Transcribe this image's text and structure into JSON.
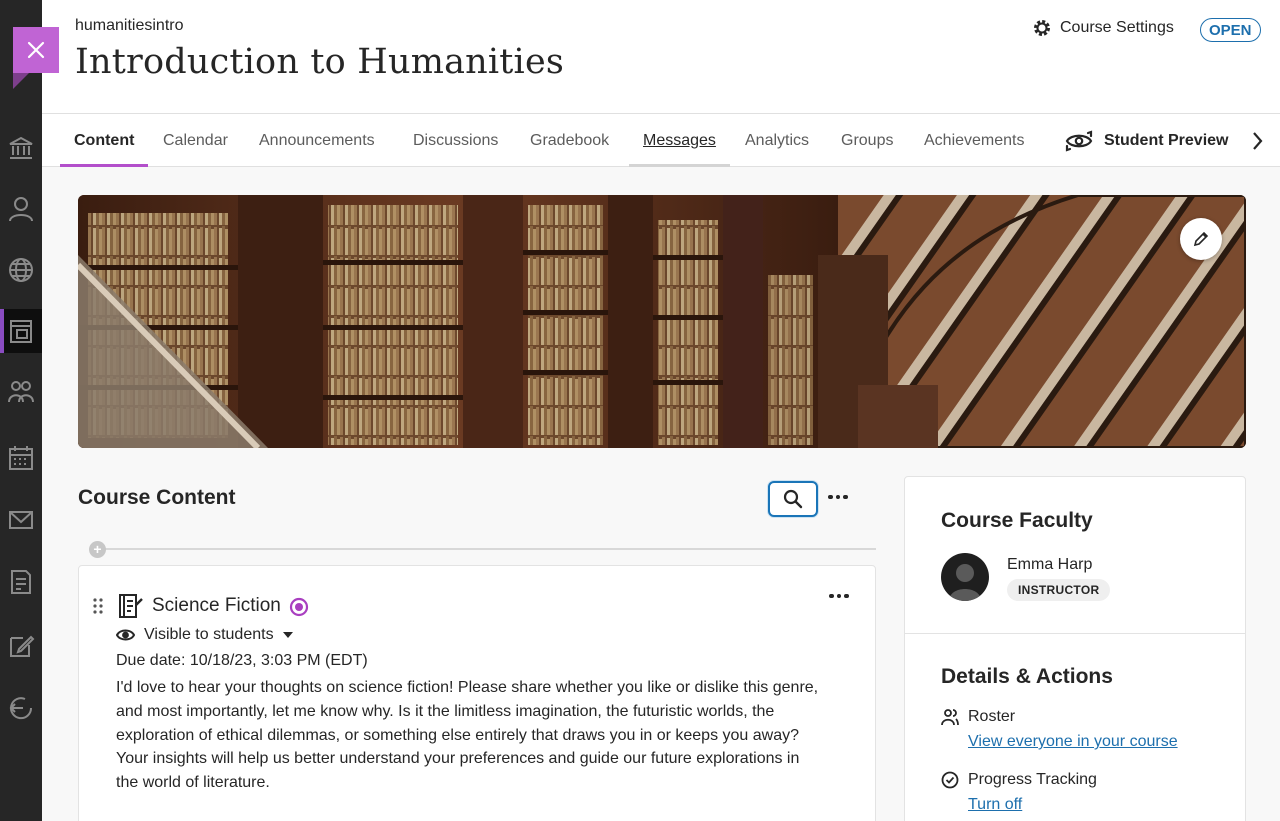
{
  "header": {
    "course_id": "humanitiesintro",
    "course_title": "Introduction to Humanities",
    "settings_label": "Course Settings",
    "status_badge": "OPEN"
  },
  "rail": {
    "items": [
      "institution-icon",
      "profile-icon",
      "globe-icon",
      "courses-icon",
      "groups-icon",
      "calendar-icon",
      "messages-icon",
      "grades-icon",
      "tools-icon",
      "sign-out-icon"
    ],
    "active_index": 3
  },
  "tabs": {
    "items": [
      {
        "label": "Content"
      },
      {
        "label": "Calendar"
      },
      {
        "label": "Announcements"
      },
      {
        "label": "Discussions"
      },
      {
        "label": "Gradebook"
      },
      {
        "label": "Messages"
      },
      {
        "label": "Analytics"
      },
      {
        "label": "Groups"
      },
      {
        "label": "Achievements"
      }
    ],
    "active": "Content",
    "student_preview_label": "Student Preview"
  },
  "course_content": {
    "title": "Course Content",
    "items": [
      {
        "title": "Science Fiction",
        "visibility": "Visible to students",
        "due_date": "Due date: 10/18/23, 3:03 PM (EDT)",
        "description": "I'd love to hear your thoughts on science fiction! Please share whether you like or dislike this genre, and most importantly, let me know why. Is it the limitless imagination, the futuristic worlds, the exploration of ethical dilemmas, or something else entirely that draws you in or keeps you away? Your insights will help us better understand your preferences and guide our future explorations in the world of literature."
      }
    ]
  },
  "side_panel": {
    "faculty_title": "Course Faculty",
    "faculty_name": "Emma Harp",
    "faculty_role": "INSTRUCTOR",
    "details_title": "Details & Actions",
    "roster_label": "Roster",
    "roster_link": "View everyone in your course",
    "progress_label": "Progress Tracking",
    "progress_link": "Turn off"
  },
  "colors": {
    "accent_purple": "#b34fcb",
    "link_blue": "#1d6fad",
    "rail_bg": "#262626"
  }
}
